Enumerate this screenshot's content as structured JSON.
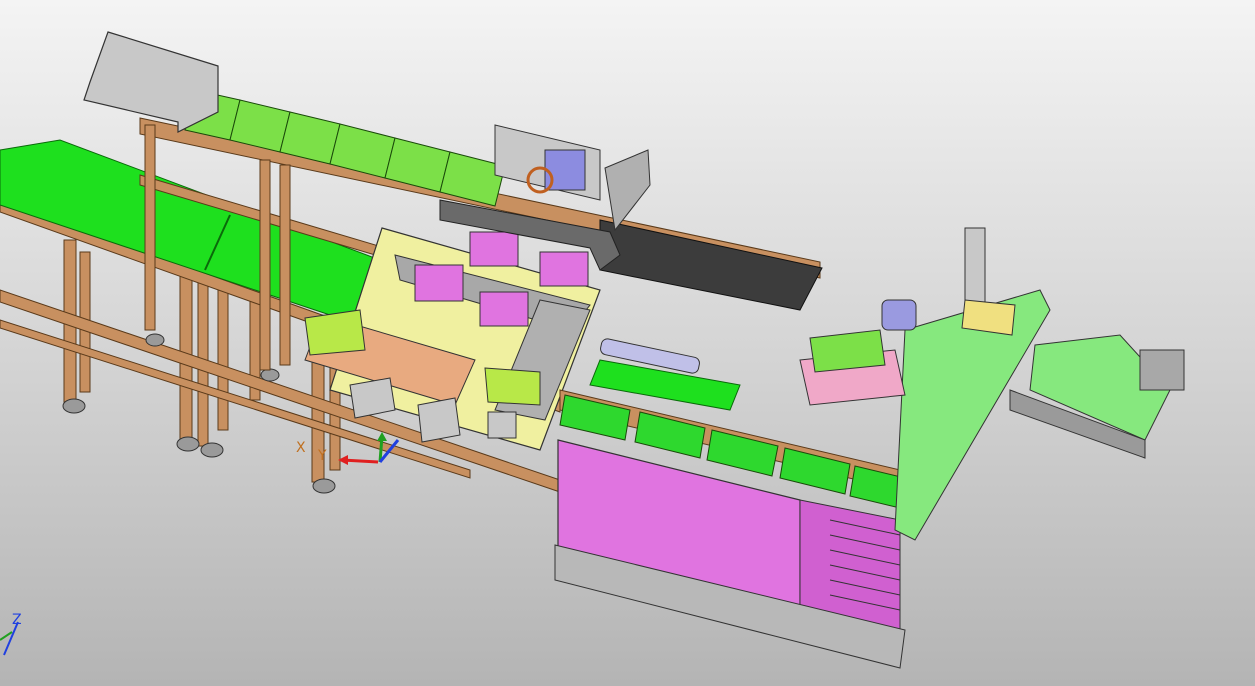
{
  "viewport": {
    "background_top": "#f4f4f4",
    "background_bottom": "#b4b4b4"
  },
  "colors": {
    "frame": "#c89060",
    "frame_dark": "#8a5a30",
    "belt_green": "#1ee01e",
    "belt_green_light": "#86e87e",
    "belt_dark": "#3c3c3c",
    "pink": "#e074e0",
    "yellow": "#f0f0a0",
    "tray_green": "#7ce048",
    "metal": "#c8c8c8",
    "blue": "#8c8ce0"
  },
  "triad": {
    "x_label": "X",
    "y_label": "Y",
    "x_color": "#e02020",
    "y_color": "#20a020",
    "z_color": "#2040e0"
  },
  "corner_triad": {
    "z_label": "Z",
    "color": "#2040e0"
  }
}
